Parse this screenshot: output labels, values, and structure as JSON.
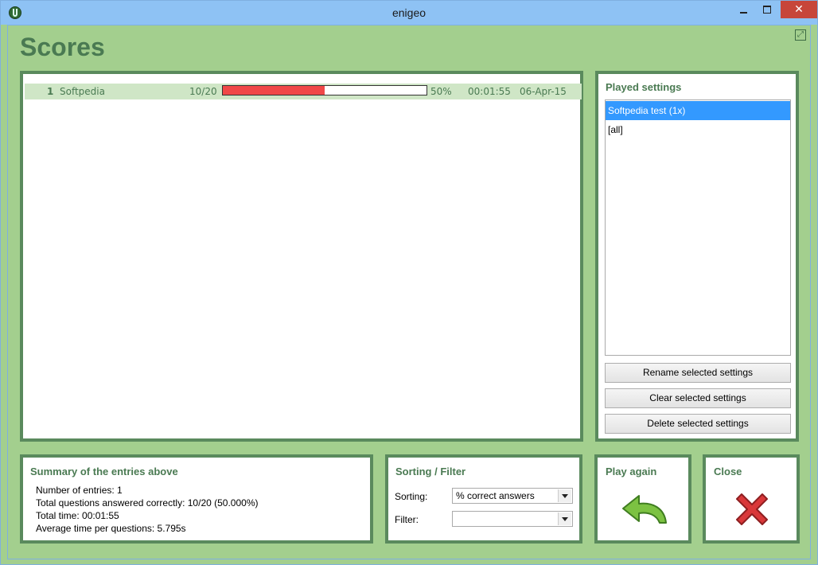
{
  "window": {
    "title": "enigeo"
  },
  "heading": "Scores",
  "scores": {
    "rows": [
      {
        "rank": "1",
        "name": "Softpedia",
        "answered": "10/20",
        "progress": 0.5,
        "percent": "50%",
        "time": "00:01:55",
        "date": "06-Apr-15"
      }
    ]
  },
  "played": {
    "title": "Played settings",
    "items": [
      "Softpedia test (1x)",
      "[all]"
    ],
    "rename_label": "Rename selected settings",
    "clear_label": "Clear selected settings",
    "delete_label": "Delete selected settings"
  },
  "summary": {
    "title": "Summary of the entries above",
    "lines": [
      "Number of entries: 1",
      "Total questions answered correctly: 10/20 (50.000%)",
      "Total time: 00:01:55",
      "Average time per questions: 5.795s"
    ]
  },
  "sortfilter": {
    "title": "Sorting / Filter",
    "sorting_label": "Sorting:",
    "sorting_value": "% correct answers",
    "filter_label": "Filter:",
    "filter_value": ""
  },
  "play_again": {
    "title": "Play again"
  },
  "close": {
    "title": "Close"
  },
  "colors": {
    "background": "#a3cf8e",
    "accent": "#4a7a52",
    "border": "#5a8a5d",
    "progress": "#f04848",
    "selection": "#3399ff"
  },
  "icons": {
    "app": "globe-icon",
    "play_again": "undo-arrow-icon",
    "close": "red-x-icon",
    "expand": "expand-icon"
  }
}
